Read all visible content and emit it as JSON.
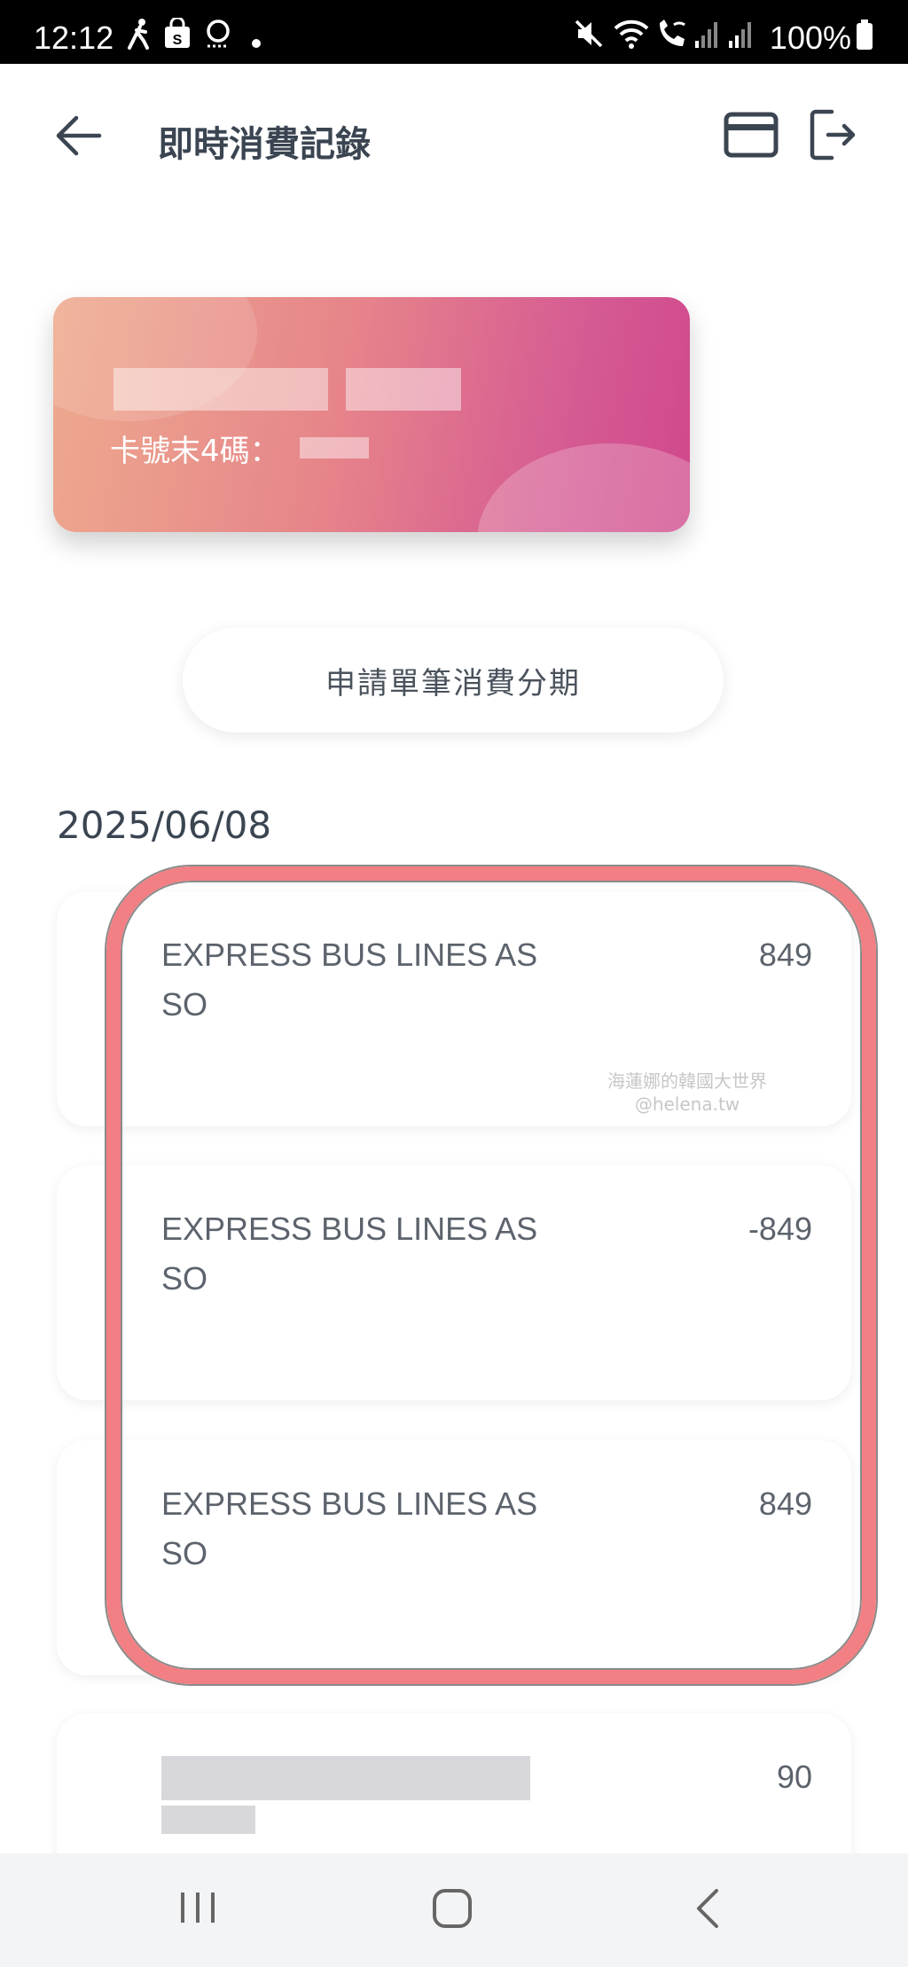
{
  "status_bar": {
    "time": "12:12",
    "battery": "100%"
  },
  "header": {
    "title": "即時消費記錄"
  },
  "card": {
    "last4_label": "卡號末4碼："
  },
  "installment_button_label": "申請單筆消費分期",
  "date": "2025/06/08",
  "transactions": [
    {
      "merchant": "EXPRESS BUS LINES AS SO",
      "amount": "849"
    },
    {
      "merchant": "EXPRESS BUS LINES AS SO",
      "amount": "-849"
    },
    {
      "merchant": "EXPRESS BUS LINES AS SO",
      "amount": "849"
    },
    {
      "merchant": "",
      "amount": "90"
    }
  ],
  "watermark": {
    "line1": "海蓮娜的韓國大世界",
    "line2": "@helena.tw"
  },
  "colors": {
    "highlight": "#f27f83",
    "card_start": "#eeaa8e",
    "card_end": "#d0488b"
  },
  "icons": [
    "walk-icon",
    "shopping-bag-icon",
    "podcast-icon",
    "mute-icon",
    "wifi-icon",
    "wifi-calling-icon",
    "signal-icon",
    "battery-icon",
    "back-arrow-icon",
    "credit-card-icon",
    "logout-icon",
    "recents-icon",
    "home-icon",
    "nav-back-icon"
  ]
}
